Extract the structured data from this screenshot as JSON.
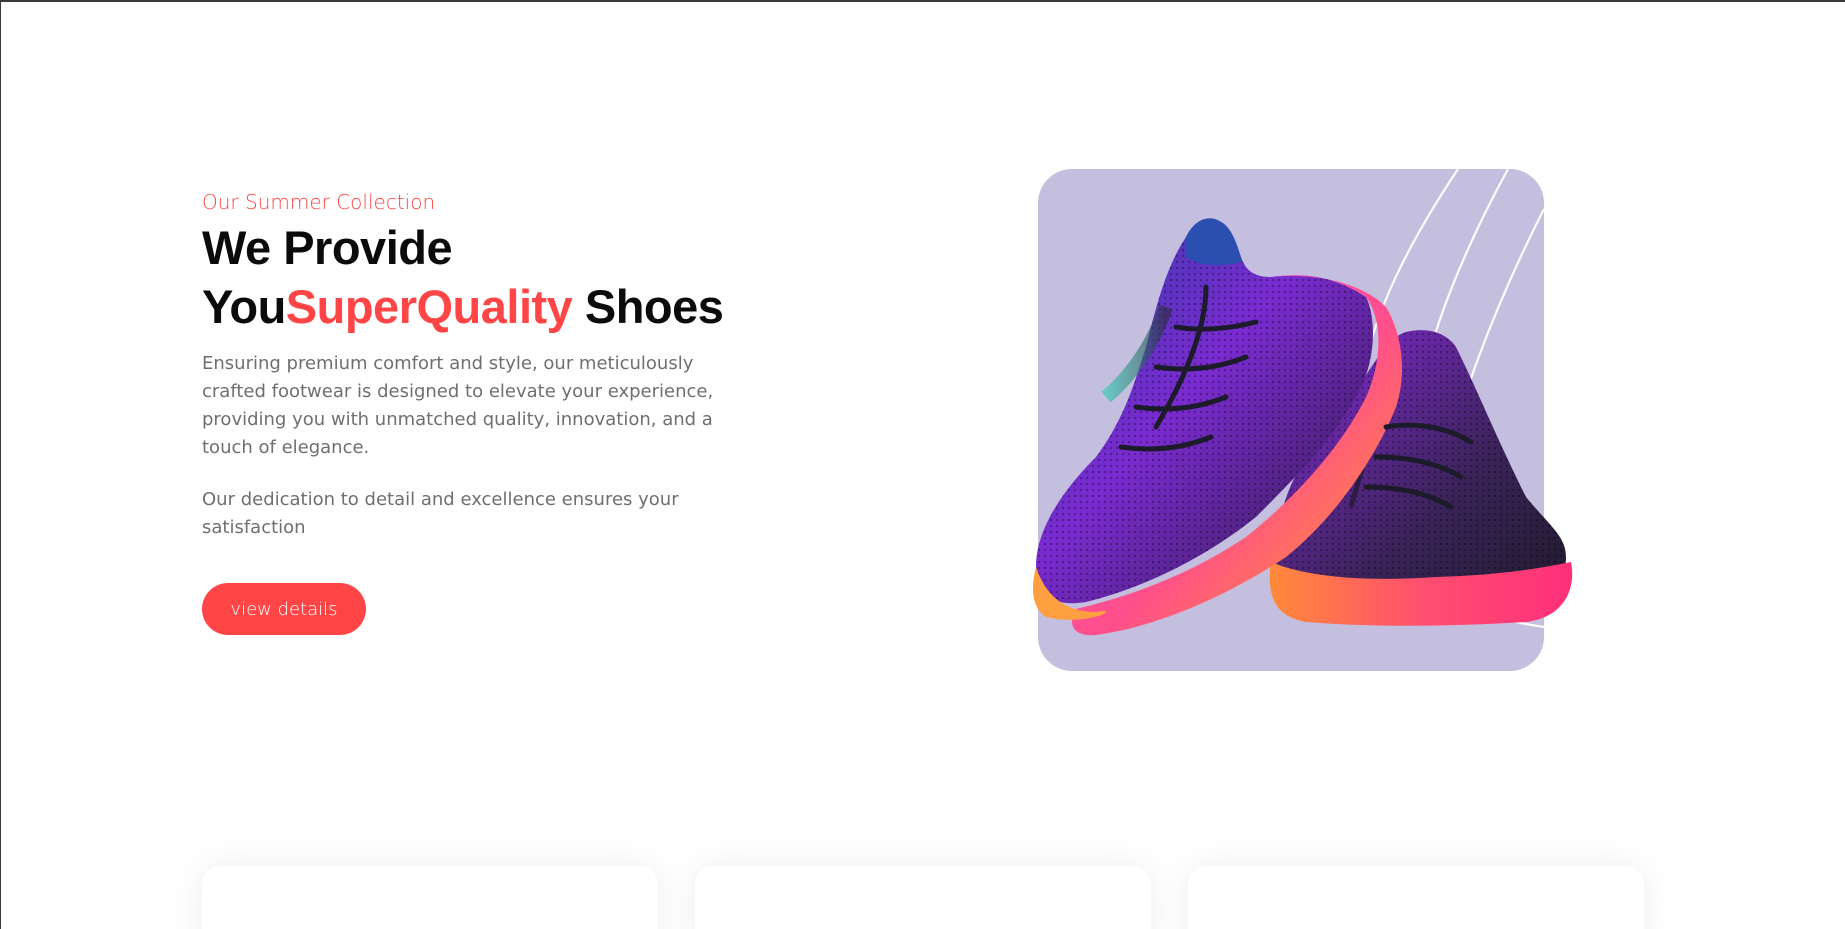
{
  "hero": {
    "eyebrow": "Our Summer Collection",
    "headline_line1": "We Provide",
    "headline_you": "You",
    "headline_accent": "SuperQuality",
    "headline_end": " Shoes",
    "paragraph1": "Ensuring premium comfort and style, our meticulously crafted footwear is designed to elevate your experience, providing you with unmatched quality, innovation, and a touch of elegance.",
    "paragraph2": "Our dedication to detail and excellence ensures your satisfaction",
    "cta_label": "view details"
  },
  "product_image": {
    "icon": "sneakers-image"
  },
  "feature_cards": [
    {
      "label": ""
    },
    {
      "label": ""
    },
    {
      "label": ""
    }
  ],
  "colors": {
    "accent": "#ff4545",
    "card_bg": "#c4bedf",
    "text_dark": "#0b0b0b",
    "text_muted": "#6f6f6f"
  }
}
